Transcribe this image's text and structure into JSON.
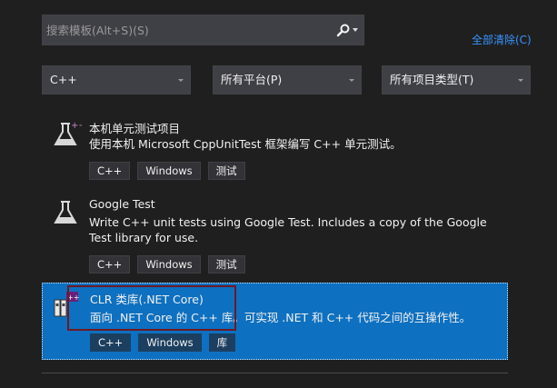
{
  "search": {
    "placeholder": "搜索模板(Alt+S)(S)"
  },
  "clear_all_label": "全部清除(C)",
  "filters": {
    "language": "C++",
    "platform": "所有平台(P)",
    "project_type": "所有项目类型(T)"
  },
  "templates": [
    {
      "title": "本机单元测试项目",
      "description": "使用本机 Microsoft CppUnitTest 框架编写 C++ 单元测试。",
      "tags": [
        "C++",
        "Windows",
        "测试"
      ],
      "icon": "flask-icon"
    },
    {
      "title": "Google Test",
      "description": "Write C++ unit tests using Google Test. Includes a copy of the Google Test library for use.",
      "tags": [
        "C++",
        "Windows",
        "测试"
      ],
      "icon": "flask-icon"
    },
    {
      "title": "CLR 类库(.NET Core)",
      "description": "面向 .NET Core 的 C++ 库。可实现 .NET 和 C++ 代码之间的互操作性。",
      "tags": [
        "C++",
        "Windows",
        "库"
      ],
      "icon": "library-icon",
      "selected": true
    }
  ],
  "colors": {
    "background": "#1f1f1f",
    "selection": "#0e70c0",
    "link": "#3794ff",
    "highlight_box": "#6d1a24"
  }
}
